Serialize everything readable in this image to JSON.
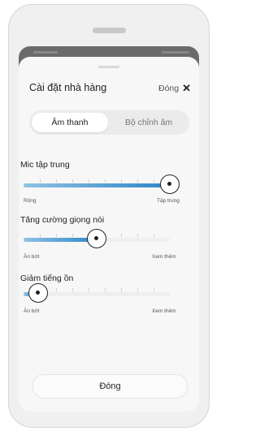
{
  "sheet": {
    "title": "Cài đặt nhà hàng",
    "close_top_label": "Đóng",
    "close_icon": "close-x-icon",
    "close_button_label": "Đóng"
  },
  "tabs": [
    {
      "label": "Âm thanh",
      "active": true
    },
    {
      "label": "Bộ chỉnh âm",
      "active": false
    }
  ],
  "sliders": [
    {
      "label": "Mic tập trung",
      "min_label": "Rộng",
      "max_label": "Tập trung",
      "value": 1.0
    },
    {
      "label": "Tăng cường giọng nói",
      "min_label": "Ăn bớt",
      "max_label": "Xem thêm",
      "value": 0.5
    },
    {
      "label": "Giảm tiếng ồn",
      "min_label": "Ăn bớt",
      "max_label": "Xem thêm",
      "value": 0.1
    }
  ],
  "colors": {
    "accent_start": "#8fc2e3",
    "accent_end": "#2f86c9"
  }
}
